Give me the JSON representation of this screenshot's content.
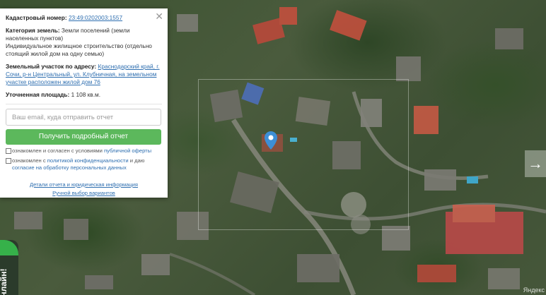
{
  "card": {
    "close_icon": "close-icon",
    "cadastral_label": "Кадастровый номер:",
    "cadastral_value": "23:49:0202003:1557",
    "category_label": "Категория земель:",
    "category_value": "Земли поселений (земли населенных пунктов)",
    "usage_value": "Индивидуальное жилищное строительство (отдельно стоящий жилой дом на одну семью)",
    "address_label": "Земельный участок по адресу:",
    "address_value": "Краснодарский край, г. Сочи, р-н Центральный, ул. Клубничная, на земельном участке расположен жилой дом 76",
    "area_label": "Уточненная площадь:",
    "area_value": "1 108 кв.м.",
    "email_placeholder": "Ваш email, куда отправить отчет",
    "email_value": "",
    "submit_label": "Получить подробный отчет",
    "consent1_text": "ознакомлен и согласен с условиями",
    "consent1_link": "публичной оферты",
    "consent2_text": "ознакомлен с",
    "consent2_link1": "политикой конфиденциальности",
    "consent2_mid": "и даю",
    "consent2_link2": "согласие на обработку персональных данных",
    "details_link": "Детали отчета и юридическая информация",
    "manual_link": "Ручной выбор вариантов"
  },
  "map": {
    "nav_left_icon": "arrow-left-icon",
    "nav_right_icon": "arrow-right-icon",
    "pin_icon": "map-pin-icon",
    "online_tab": "Онлайн!",
    "yandex": "Яндекс"
  },
  "colors": {
    "accent_button": "#5cb85c",
    "link": "#2f6fb0",
    "pin": "#3d8fd6",
    "online_green": "#36b14a"
  }
}
